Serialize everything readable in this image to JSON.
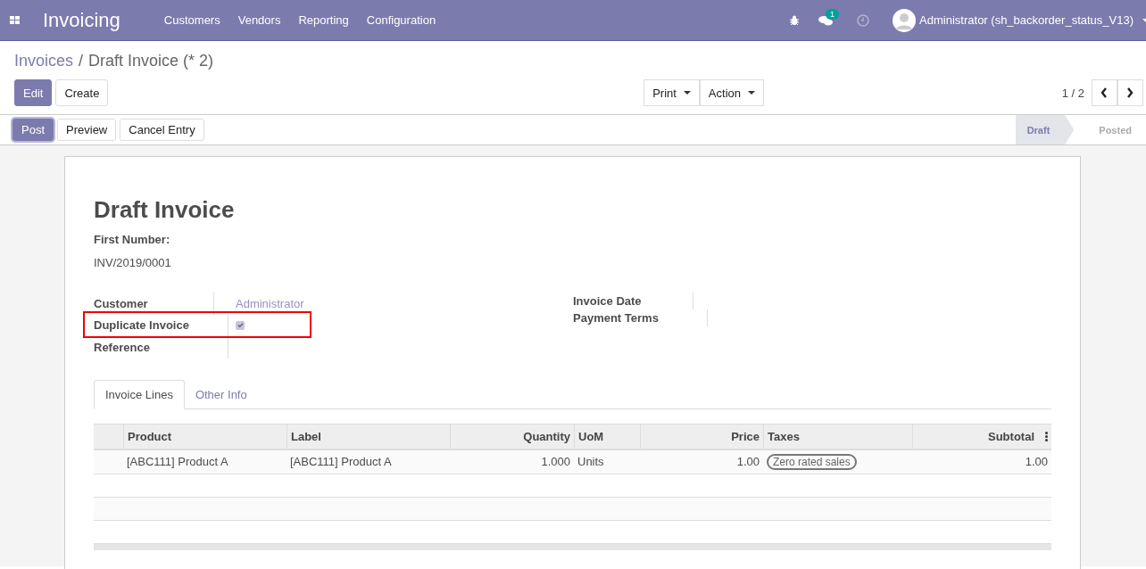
{
  "navbar": {
    "app_title": "Invoicing",
    "menu": [
      "Customers",
      "Vendors",
      "Reporting",
      "Configuration"
    ],
    "message_count": "1",
    "user": "Administrator (sh_backorder_status_V13)"
  },
  "breadcrumb": {
    "parent": "Invoices",
    "separator": "/",
    "current": "Draft Invoice (* 2)"
  },
  "buttons": {
    "edit": "Edit",
    "create": "Create",
    "print": "Print",
    "action": "Action",
    "pager": "1 / 2"
  },
  "statusbar": {
    "buttons": [
      {
        "label": "Post",
        "primary": true
      },
      {
        "label": "Preview",
        "primary": false
      },
      {
        "label": "Cancel Entry",
        "primary": false
      }
    ],
    "stages": [
      {
        "label": "Draft",
        "selected": true
      },
      {
        "label": "Posted",
        "selected": false
      }
    ]
  },
  "sheet": {
    "title": "Draft Invoice",
    "first_number_label": "First Number:",
    "first_number": "INV/2019/0001",
    "left_fields": [
      {
        "label": "Customer",
        "kind": "link",
        "value": "Administrator"
      },
      {
        "label": "Duplicate Invoice",
        "kind": "checkbox",
        "checked": true
      },
      {
        "label": "Reference",
        "kind": "text"
      }
    ],
    "right_fields": [
      {
        "label": "Invoice Date"
      },
      {
        "label": "Payment Terms"
      }
    ],
    "tabs": [
      {
        "label": "Invoice Lines",
        "selected": true
      },
      {
        "label": "Other Info",
        "selected": false
      }
    ],
    "table": {
      "columns": [
        {
          "label": "Product"
        },
        {
          "label": "Label"
        },
        {
          "label": "Quantity"
        },
        {
          "label": "UoM"
        },
        {
          "label": "Price"
        },
        {
          "label": "Taxes"
        },
        {
          "label": "Subtotal"
        }
      ],
      "rows": [
        {
          "product": "[ABC111] Product A",
          "label": "[ABC111] Product A",
          "quantity": "1.000",
          "uom": "Units",
          "price": "1.00",
          "tax": "Zero rated sales",
          "subtotal": "1.00"
        }
      ]
    }
  }
}
